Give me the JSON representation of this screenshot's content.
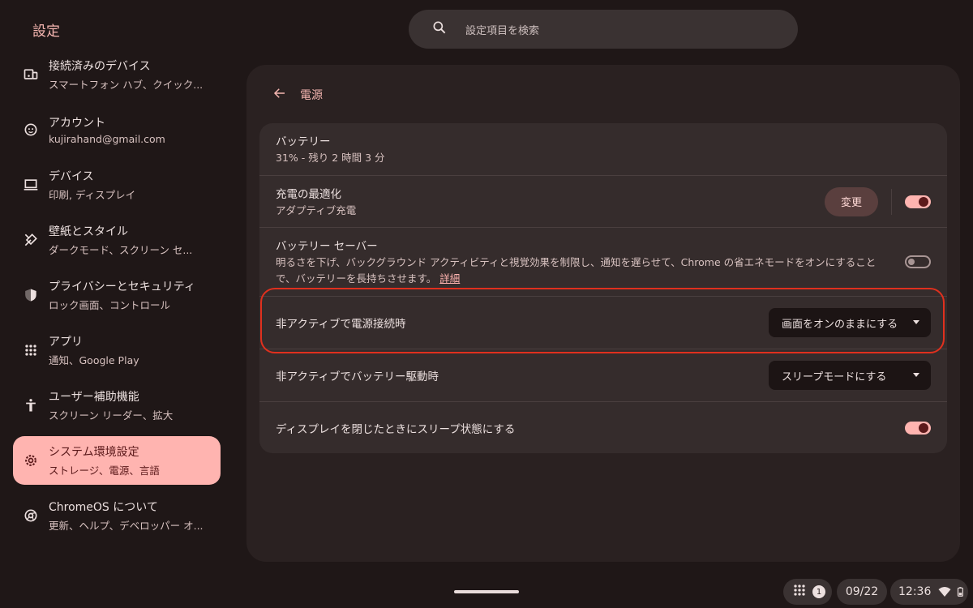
{
  "app_title": "設定",
  "search": {
    "placeholder": "設定項目を検索"
  },
  "sidebar": {
    "items": [
      {
        "title": "接続済みのデバイス",
        "sub": "スマートフォン ハブ、クイック..."
      },
      {
        "title": "アカウント",
        "sub": "kujirahand@gmail.com"
      },
      {
        "title": "デバイス",
        "sub": "印刷, ディスプレイ"
      },
      {
        "title": "壁紙とスタイル",
        "sub": "ダークモード、スクリーン セ..."
      },
      {
        "title": "プライバシーとセキュリティ",
        "sub": "ロック画面、コントロール"
      },
      {
        "title": "アプリ",
        "sub": "通知、Google Play"
      },
      {
        "title": "ユーザー補助機能",
        "sub": "スクリーン リーダー、拡大"
      },
      {
        "title": "システム環境設定",
        "sub": "ストレージ、電源、言語"
      },
      {
        "title": "ChromeOS について",
        "sub": "更新、ヘルプ、デベロッパー オ..."
      }
    ]
  },
  "page": {
    "title": "電源"
  },
  "settings": {
    "battery": {
      "title": "バッテリー",
      "sub": "31% - 残り 2 時間 3 分"
    },
    "charge_opt": {
      "title": "充電の最適化",
      "sub": "アダプティブ充電",
      "button": "変更",
      "enabled": true
    },
    "battery_saver": {
      "title": "バッテリー セーバー",
      "sub": "明るさを下げ、バックグラウンド アクティビティと視覚効果を制限し、通知を遅らせて、Chrome の省エネモードをオンにすることで、バッテリーを長持ちさせます。",
      "link": "詳細",
      "enabled": false
    },
    "idle_plugged": {
      "title": "非アクティブで電源接続時",
      "value": "画面をオンのままにする"
    },
    "idle_battery": {
      "title": "非アクティブでバッテリー駆動時",
      "value": "スリープモードにする"
    },
    "lid_sleep": {
      "title": "ディスプレイを閉じたときにスリープ状態にする",
      "enabled": true
    }
  },
  "shelf": {
    "notification_count": "1",
    "date": "09/22",
    "time": "12:36"
  },
  "colors": {
    "accent": "#ffb4b0",
    "highlight": "#e0301e",
    "background": "#1f1717"
  }
}
